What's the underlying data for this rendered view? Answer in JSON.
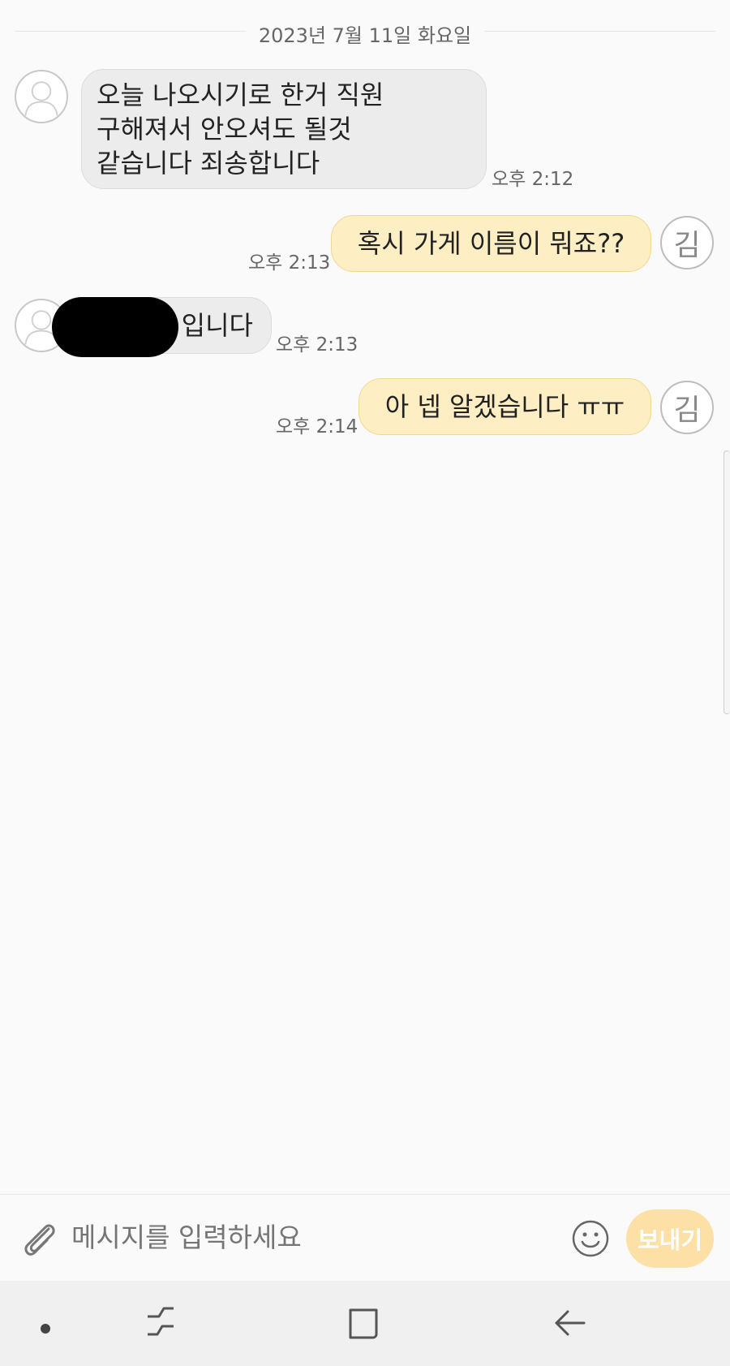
{
  "chat": {
    "date": "2023년 7월 11일 화요일",
    "messages": [
      {
        "side": "in",
        "text": "오늘 나오시기로 한거 직원\n구해져서 안오셔도 될것\n같습니다 죄송합니다",
        "time": "오후 2:12"
      },
      {
        "side": "out",
        "text": "혹시 가게 이름이 뭐죠??",
        "time": "오후 2:13",
        "avatar_initial": "김"
      },
      {
        "side": "in",
        "text": "입니다",
        "time": "오후 2:13",
        "redacted": true
      },
      {
        "side": "out",
        "text": "아 넵 알겠습니다 ㅠㅠ",
        "time": "오후 2:14",
        "avatar_initial": "김"
      }
    ]
  },
  "composer": {
    "placeholder": "메시지를 입력하세요",
    "send_label": "보내기",
    "attach_icon": "paperclip-icon",
    "emoji_icon": "smiley-icon"
  },
  "navbar": {
    "items": [
      "dot-icon",
      "recent-apps-icon",
      "home-icon",
      "back-icon"
    ]
  },
  "colors": {
    "outgoing_bubble": "#fdeec4",
    "incoming_bubble": "#ececec",
    "send_button": "#fde0a6",
    "background": "#fafafa"
  }
}
